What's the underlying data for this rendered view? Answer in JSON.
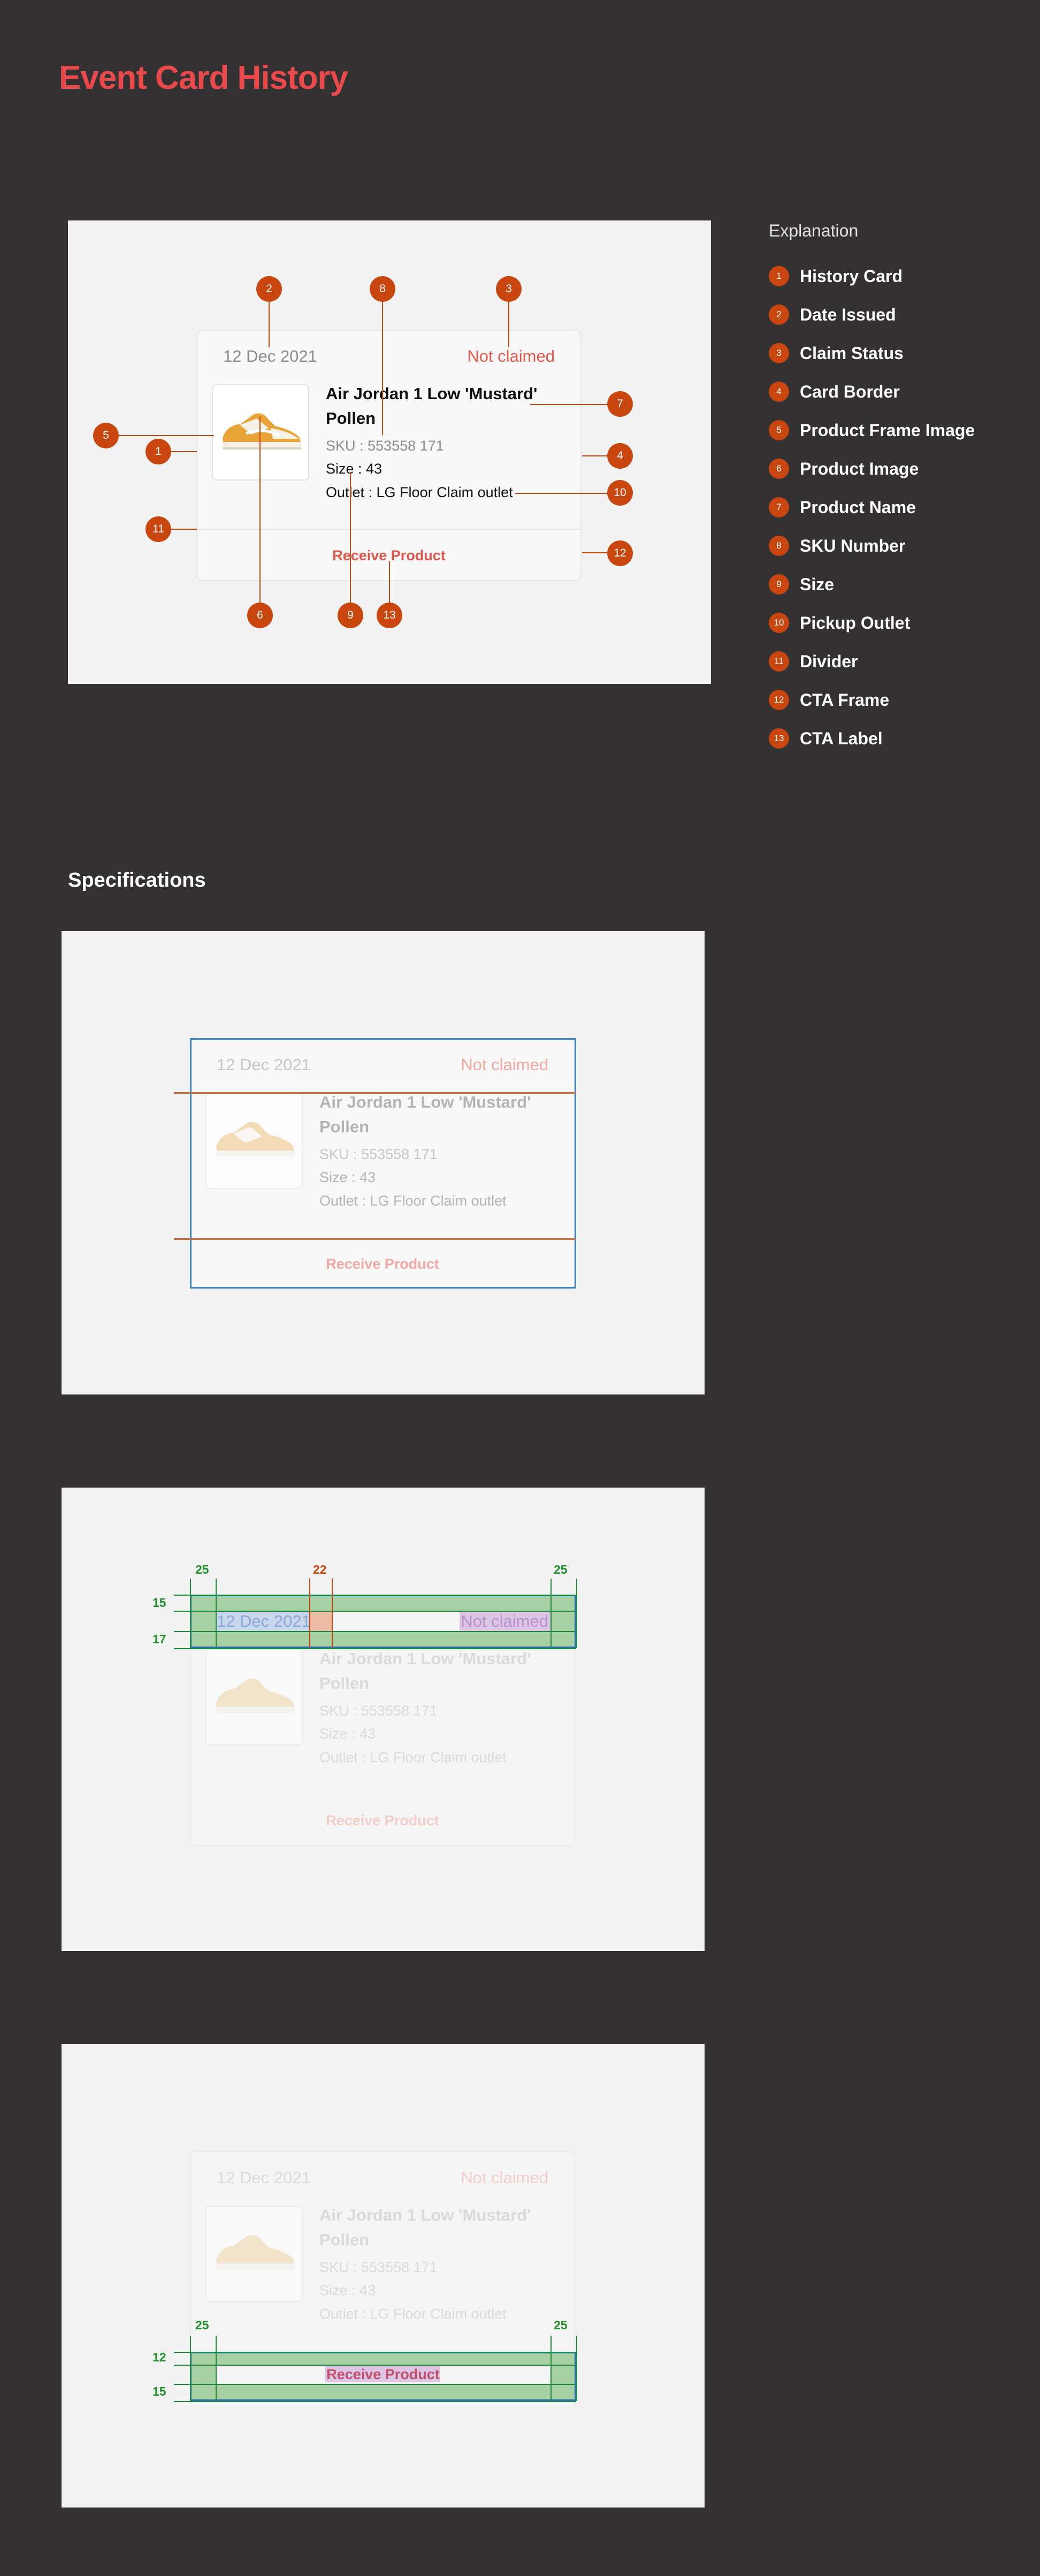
{
  "page": {
    "title": "Event Card History"
  },
  "card": {
    "date": "12 Dec 2021",
    "status": "Not claimed",
    "product_name": "Air Jordan 1 Low 'Mustard' Pollen",
    "sku": "SKU : 553558 171",
    "size": "Size : 43",
    "outlet": "Outlet : LG Floor Claim outlet",
    "cta": "Receive Product"
  },
  "callouts": [
    "1",
    "2",
    "3",
    "4",
    "5",
    "6",
    "7",
    "8",
    "9",
    "10",
    "11",
    "12",
    "13"
  ],
  "explanation": {
    "title": "Explanation",
    "items": [
      {
        "num": "1",
        "label": "History Card"
      },
      {
        "num": "2",
        "label": "Date Issued"
      },
      {
        "num": "3",
        "label": "Claim Status"
      },
      {
        "num": "4",
        "label": "Card Border"
      },
      {
        "num": "5",
        "label": "Product Frame Image"
      },
      {
        "num": "6",
        "label": "Product Image"
      },
      {
        "num": "7",
        "label": "Product Name"
      },
      {
        "num": "8",
        "label": "SKU Number"
      },
      {
        "num": "9",
        "label": "Size"
      },
      {
        "num": "10",
        "label": "Pickup Outlet"
      },
      {
        "num": "11",
        "label": "Divider"
      },
      {
        "num": "12",
        "label": "CTA Frame"
      },
      {
        "num": "13",
        "label": "CTA Label"
      }
    ]
  },
  "specifications": {
    "title": "Specifications",
    "header_padding": {
      "left": "25",
      "right": "25",
      "gap": "22",
      "top": "15",
      "bottom": "17"
    },
    "cta_padding": {
      "left": "25",
      "right": "25",
      "top": "12",
      "bottom": "15"
    }
  },
  "colors": {
    "background": "#333132",
    "accent": "#ea4a4b",
    "callout": "#c9470f",
    "spec_green": "#1a8a36",
    "spec_blue": "#3b85c8"
  }
}
